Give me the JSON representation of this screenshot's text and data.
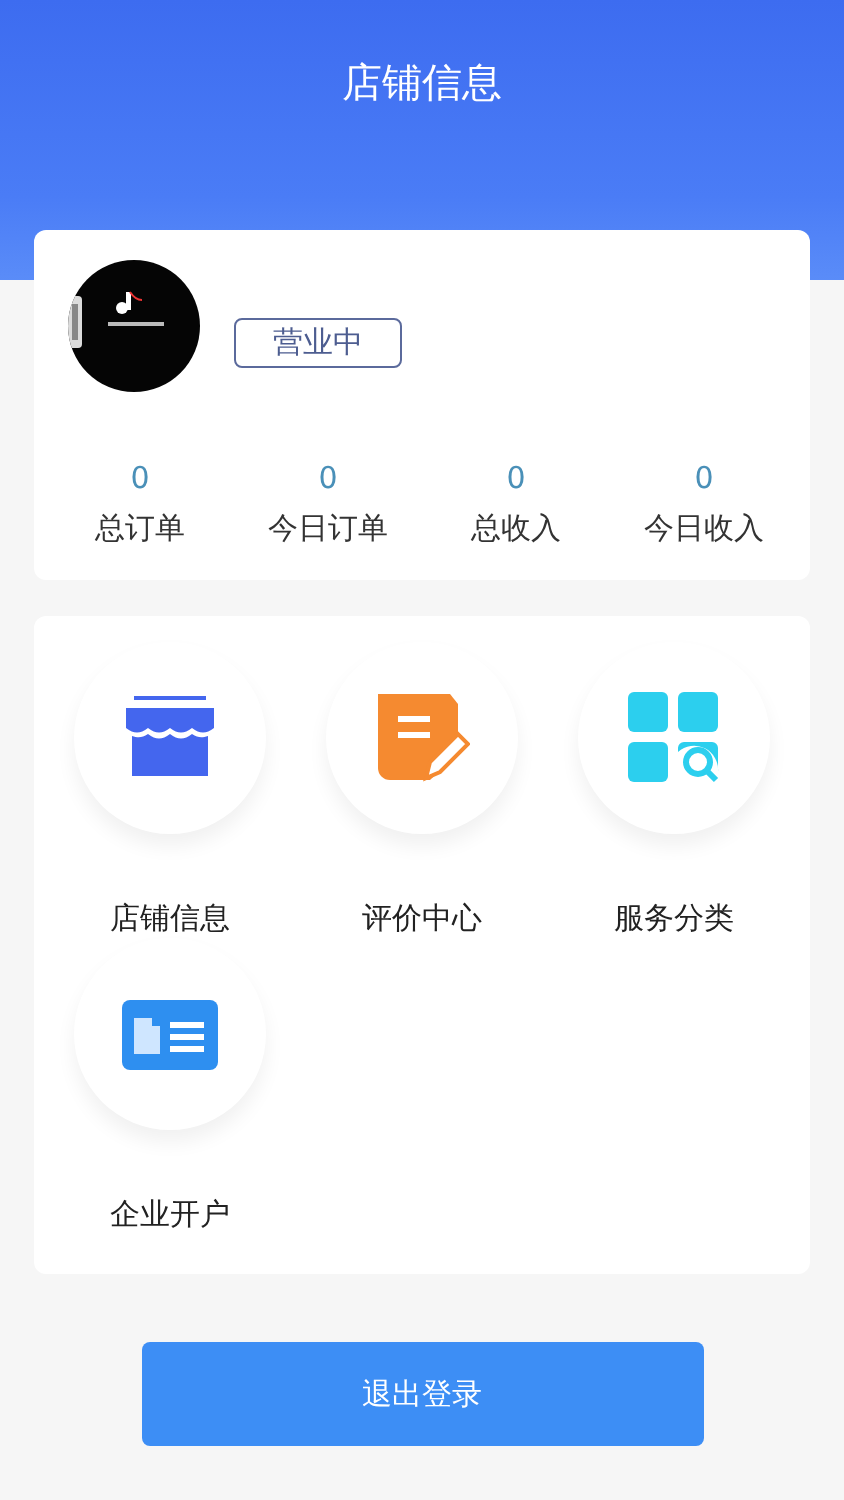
{
  "header": {
    "title": "店铺信息"
  },
  "shop": {
    "status": "营业中"
  },
  "stats": [
    {
      "value": "0",
      "label": "总订单"
    },
    {
      "value": "0",
      "label": "今日订单"
    },
    {
      "value": "0",
      "label": "总收入"
    },
    {
      "value": "0",
      "label": "今日收入"
    }
  ],
  "menu": [
    {
      "kind": "store",
      "label": "店铺信息"
    },
    {
      "kind": "review",
      "label": "评价中心"
    },
    {
      "kind": "category",
      "label": "服务分类"
    },
    {
      "kind": "enterprise",
      "label": "企业开户"
    }
  ],
  "logout_button": "退出登录"
}
